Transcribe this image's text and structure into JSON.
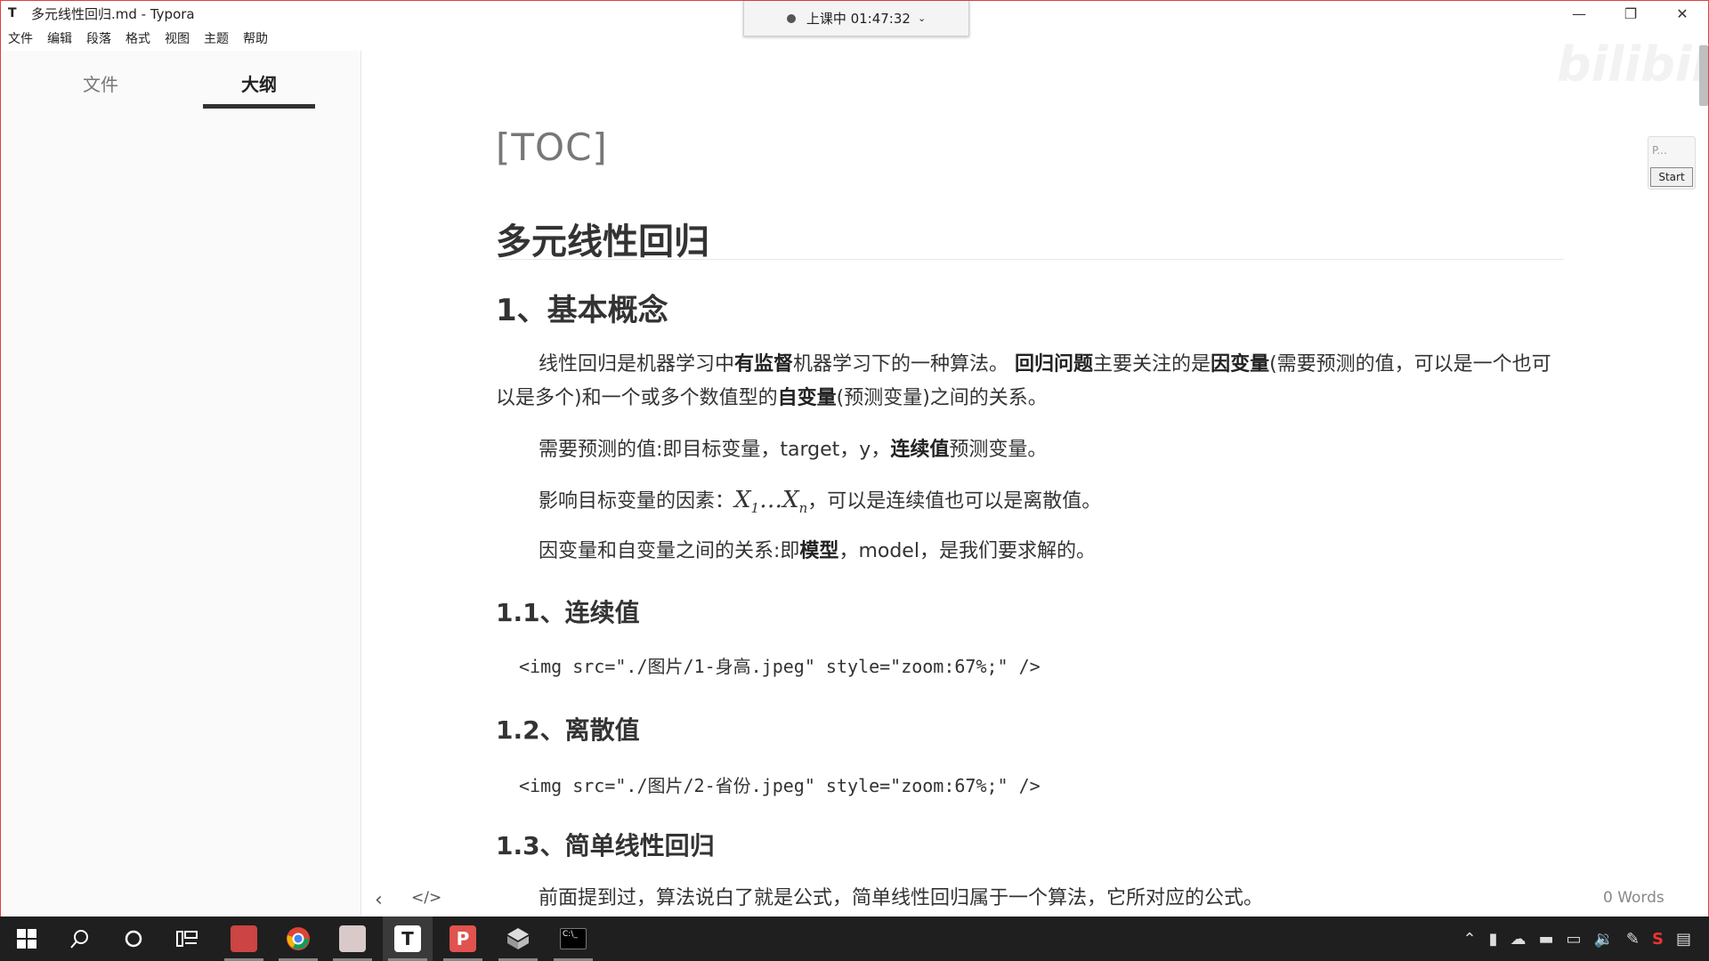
{
  "window": {
    "app_icon": "T",
    "title": "多元线性回归.md - Typora",
    "minimize": "—",
    "restore": "❐",
    "close": "✕"
  },
  "session_bar": {
    "label": "上课中 01:47:32",
    "chevron": "⌄"
  },
  "menu": [
    "文件",
    "编辑",
    "段落",
    "格式",
    "视图",
    "主题",
    "帮助"
  ],
  "sidebar": {
    "tab_files": "文件",
    "tab_outline": "大纲"
  },
  "doc": {
    "toc": "[TOC]",
    "h1": "多元线性回归",
    "h2_basic": "1、基本概念",
    "p1_a": "线性回归是机器学习中",
    "p1_b": "有监督",
    "p1_c": "机器学习下的一种算法。 ",
    "p1_d": "回归问题",
    "p1_e": "主要关注的是",
    "p1_f": "因变量",
    "p1_g": "(需要预测的值，可以是一个也可以是多个)和一个或多个数值型的",
    "p1_h": "自变量",
    "p1_i": "(预测变量)之间的关系。",
    "p2_a": "需要预测的值:即目标变量，target，y，",
    "p2_b": "连续值",
    "p2_c": "预测变量。",
    "p3_a": "影响目标变量的因素：",
    "p3_x1": "X",
    "p3_s1": "1",
    "p3_dots": "…",
    "p3_xn": "X",
    "p3_sn": "n",
    "p3_b": "，可以是连续值也可以是离散值。",
    "p4_a": "因变量和自变量之间的关系:即",
    "p4_b": "模型",
    "p4_c": "，model，是我们要求解的。",
    "h3_1": "1.1、连续值",
    "code1": "<img src=\"./图片/1-身高.jpeg\" style=\"zoom:67%;\" />",
    "h3_2": "1.2、离散值",
    "code2": "<img src=\"./图片/2-省份.jpeg\" style=\"zoom:67%;\" />",
    "h3_3": "1.3、简单线性回归",
    "p5": "前面提到过，算法说白了就是公式，简单线性回归属于一个算法，它所对应的公式。"
  },
  "footer": {
    "nav_left": "‹",
    "source_toggle": "</>",
    "word_count": "0 Words"
  },
  "pwidget": {
    "label": "P...",
    "start": "Start"
  },
  "watermark": "bilibili",
  "taskbar": {
    "start_icon": "windows-logo-icon",
    "search_icon": "search-icon",
    "cortana_icon": "circle-icon",
    "taskview_icon": "task-view-icon",
    "typora_letter": "T",
    "terminal_label": "C:\\_"
  },
  "colors": {
    "accent_border": "#e04040",
    "taskbar_bg": "#1f1f1f",
    "text": "#333333"
  }
}
